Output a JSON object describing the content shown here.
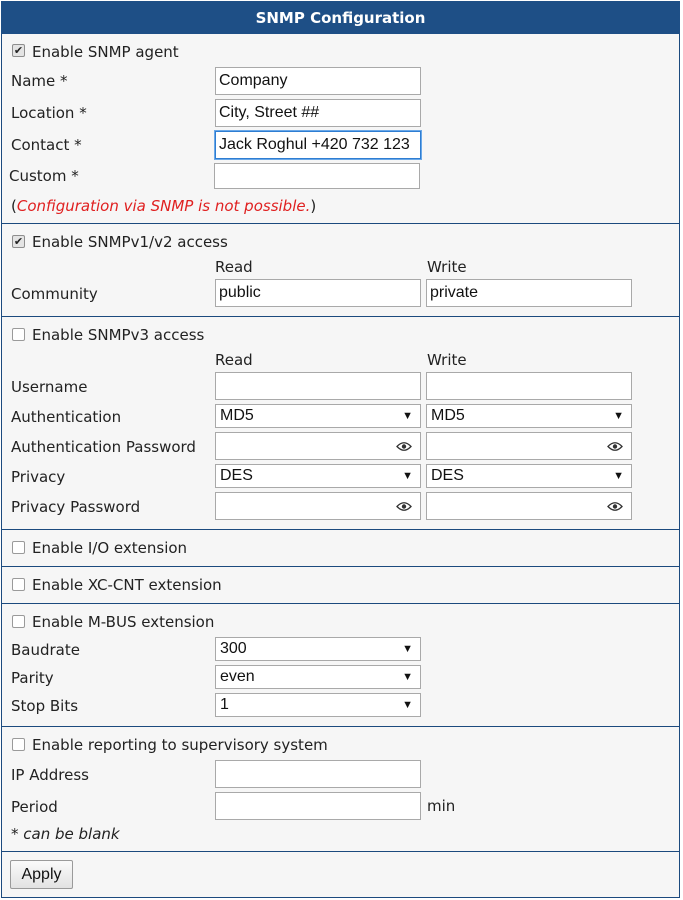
{
  "title": "SNMP Configuration",
  "agent": {
    "enable_label": "Enable SNMP agent",
    "enabled": true,
    "name_label": "Name *",
    "name_value": "Company",
    "location_label": "Location *",
    "location_value": "City, Street ##",
    "contact_label": "Contact *",
    "contact_value": "Jack Roghul +420 732 123",
    "custom_label": "Custom *",
    "custom_value": "",
    "note_open": "(",
    "note_text": "Configuration via SNMP is not possible.",
    "note_close": ")"
  },
  "v12": {
    "enable_label": "Enable SNMPv1/v2 access",
    "enabled": true,
    "read_header": "Read",
    "write_header": "Write",
    "community_label": "Community",
    "community_read": "public",
    "community_write": "private"
  },
  "v3": {
    "enable_label": "Enable SNMPv3 access",
    "enabled": false,
    "read_header": "Read",
    "write_header": "Write",
    "username_label": "Username",
    "auth_label": "Authentication",
    "auth_read": "MD5",
    "auth_write": "MD5",
    "auth_pw_label": "Authentication Password",
    "privacy_label": "Privacy",
    "privacy_read": "DES",
    "privacy_write": "DES",
    "privacy_pw_label": "Privacy Password"
  },
  "io": {
    "enable_label": "Enable I/O extension",
    "enabled": false
  },
  "xc": {
    "enable_label": "Enable XC-CNT extension",
    "enabled": false
  },
  "mbus": {
    "enable_label": "Enable M-BUS extension",
    "enabled": false,
    "baudrate_label": "Baudrate",
    "baudrate_value": "300",
    "parity_label": "Parity",
    "parity_value": "even",
    "stopbits_label": "Stop Bits",
    "stopbits_value": "1"
  },
  "reporting": {
    "enable_label": "Enable reporting to supervisory system",
    "enabled": false,
    "ip_label": "IP Address",
    "ip_value": "",
    "period_label": "Period",
    "period_value": "",
    "period_unit": "min",
    "footnote": "* can be blank"
  },
  "apply_label": "Apply",
  "icons": {
    "eye": "eye-icon",
    "dropdown": "chevron-down-icon",
    "check": "checkmark-icon"
  }
}
